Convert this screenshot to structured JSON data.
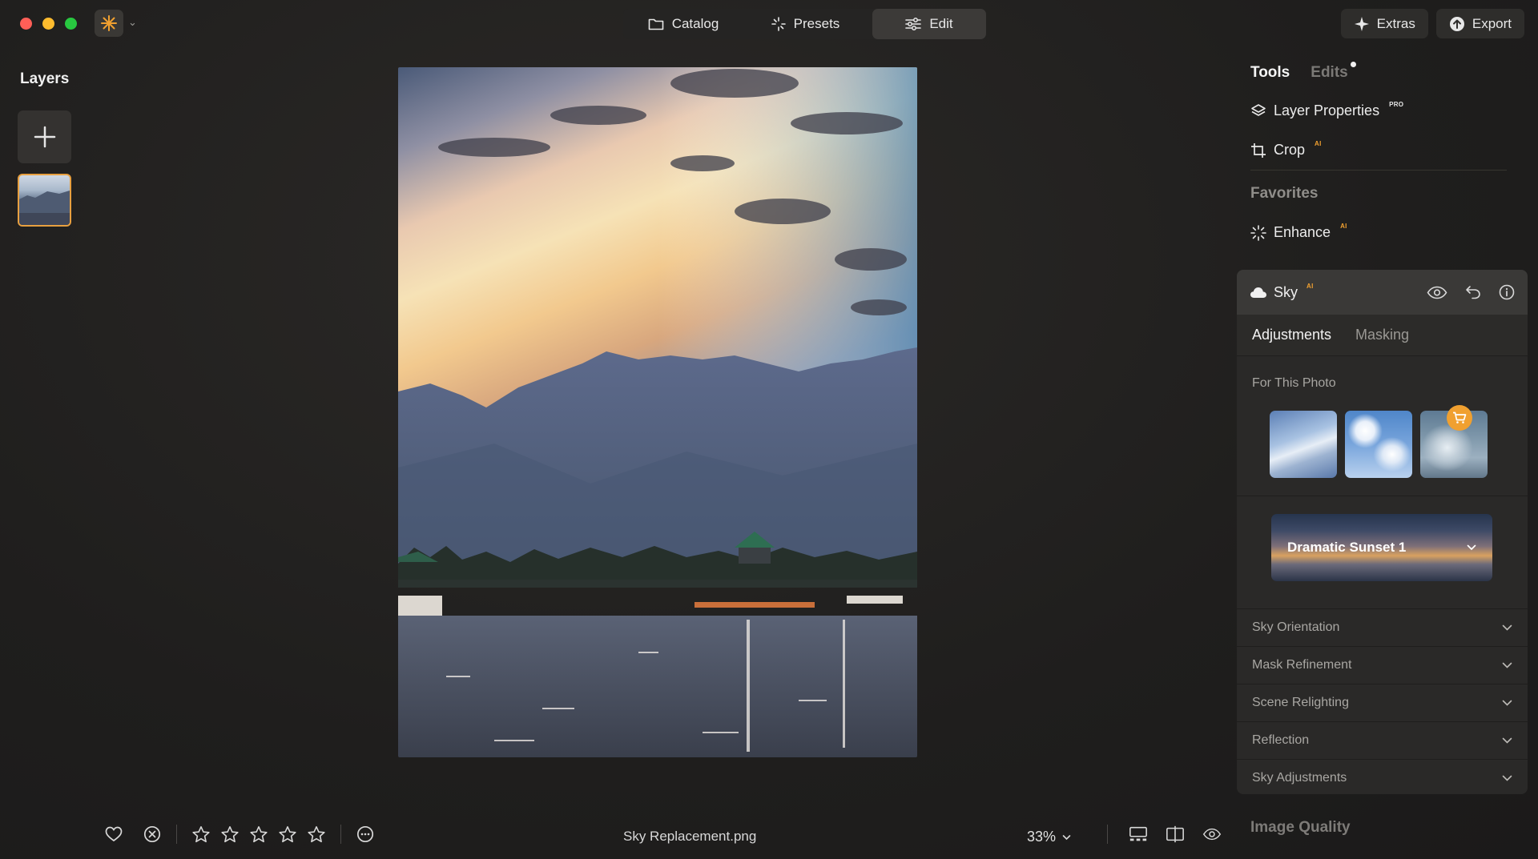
{
  "window": {
    "traffic_lights": [
      "close",
      "minimize",
      "zoom"
    ]
  },
  "topnav": {
    "catalog_label": "Catalog",
    "presets_label": "Presets",
    "edit_label": "Edit",
    "active": "Edit"
  },
  "rightnav": {
    "extras_label": "Extras",
    "export_label": "Export"
  },
  "layers": {
    "title": "Layers"
  },
  "bottom": {
    "filename": "Sky Replacement.png",
    "zoom": "33%",
    "stars": 0
  },
  "panel": {
    "tab_tools": "Tools",
    "tab_edits": "Edits",
    "tools": [
      {
        "label": "Layer Properties",
        "badge": "PRO"
      },
      {
        "label": "Crop",
        "badge": "AI"
      }
    ],
    "favorites_title": "Favorites",
    "favorites": [
      {
        "label": "Enhance",
        "badge": "AI"
      }
    ],
    "sky": {
      "title": "Sky",
      "badge": "AI",
      "tab_adjustments": "Adjustments",
      "tab_masking": "Masking",
      "for_this_photo": "For This Photo",
      "selected_preset": "Dramatic Sunset 1",
      "sections": [
        "Sky Orientation",
        "Mask Refinement",
        "Scene Relighting",
        "Reflection",
        "Sky Adjustments"
      ]
    },
    "image_quality": "Image Quality"
  },
  "colors": {
    "accent": "#f0a030",
    "close": "#ff5f57",
    "minimize": "#febc2e",
    "zoom": "#28c840",
    "background": "#1f1e1d"
  }
}
